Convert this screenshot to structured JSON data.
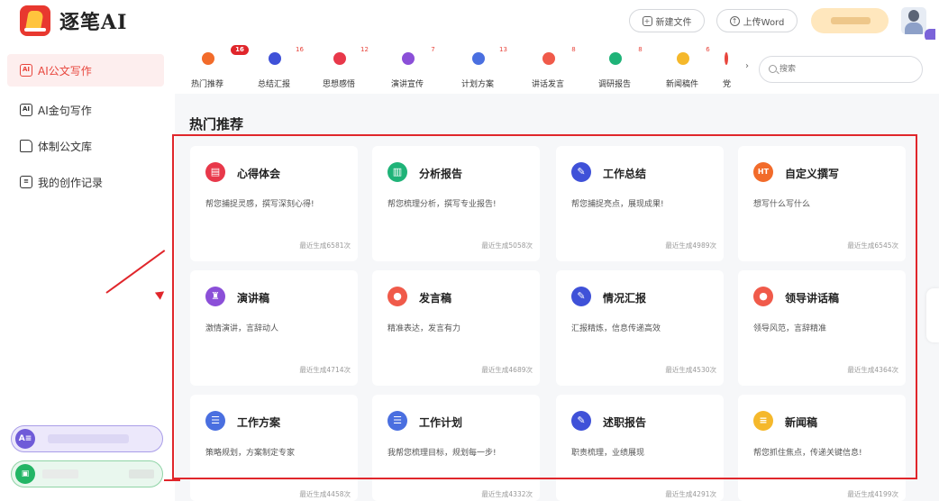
{
  "app": {
    "name": "逐笔AI"
  },
  "header": {
    "new_file": "新建文件",
    "upload_word": "上传Word"
  },
  "sidebar": {
    "items": [
      {
        "label": "AI公文写作",
        "active": true,
        "icon": "document-ai-icon"
      },
      {
        "label": "AI金句写作",
        "active": false,
        "icon": "quote-icon"
      },
      {
        "label": "体制公文库",
        "active": false,
        "icon": "folder-icon"
      },
      {
        "label": "我的创作记录",
        "active": false,
        "icon": "record-icon"
      }
    ],
    "bottom_pills": [
      {
        "icon_text": "A≡",
        "color": "#6f5bd8"
      },
      {
        "icon_text": "▣",
        "color": "#23b565"
      }
    ]
  },
  "tabs": [
    {
      "label": "热门推荐",
      "badge": "16",
      "color": "#f26b2a"
    },
    {
      "label": "总结汇报",
      "badge": "16",
      "color": "#3f51d8"
    },
    {
      "label": "思想感悟",
      "badge": "12",
      "color": "#e8384a"
    },
    {
      "label": "演讲宣传",
      "badge": "7",
      "color": "#8b4fd8"
    },
    {
      "label": "计划方案",
      "badge": "13",
      "color": "#4a6fe0"
    },
    {
      "label": "讲话发言",
      "badge": "8",
      "color": "#f05a4a"
    },
    {
      "label": "调研报告",
      "badge": "8",
      "color": "#1fb378"
    },
    {
      "label": "新闻稿件",
      "badge": "6",
      "color": "#f5b82b"
    },
    {
      "label": "党",
      "badge": "",
      "color": "#e8453c"
    }
  ],
  "search": {
    "placeholder": "搜索"
  },
  "section": {
    "title": "热门推荐"
  },
  "cards": [
    {
      "title": "心得体会",
      "desc": "帮您捕捉灵感，撰写深刻心得!",
      "count": "最近生成6581次",
      "color": "#e8384a",
      "icon": "heart-note-icon"
    },
    {
      "title": "分析报告",
      "desc": "帮您梳理分析，撰写专业报告!",
      "count": "最近生成5058次",
      "color": "#1fb378",
      "icon": "chart-doc-icon"
    },
    {
      "title": "工作总结",
      "desc": "帮您捕捉亮点，展现成果!",
      "count": "最近生成4989次",
      "color": "#3f51d8",
      "icon": "pen-doc-icon"
    },
    {
      "title": "自定义撰写",
      "desc": "想写什么写什么",
      "count": "最近生成6545次",
      "color": "#f26b2a",
      "icon": "flame-hot-icon"
    },
    {
      "title": "演讲稿",
      "desc": "激情演讲，言辞动人",
      "count": "最近生成4714次",
      "color": "#8b4fd8",
      "icon": "podium-icon"
    },
    {
      "title": "发言稿",
      "desc": "精准表达，发言有力",
      "count": "最近生成4689次",
      "color": "#f05a4a",
      "icon": "speaker-icon"
    },
    {
      "title": "情况汇报",
      "desc": "汇报精炼，信息传递高效",
      "count": "最近生成4530次",
      "color": "#3f51d8",
      "icon": "pen-doc-icon"
    },
    {
      "title": "领导讲话稿",
      "desc": "领导风范，言辞精准",
      "count": "最近生成4364次",
      "color": "#f05a4a",
      "icon": "speaker-icon"
    },
    {
      "title": "工作方案",
      "desc": "策略规划，方案制定专家",
      "count": "最近生成4458次",
      "color": "#4a6fe0",
      "icon": "plan-icon"
    },
    {
      "title": "工作计划",
      "desc": "我帮您梳理目标，规划每一步!",
      "count": "最近生成4332次",
      "color": "#4a6fe0",
      "icon": "plan-icon"
    },
    {
      "title": "述职报告",
      "desc": "职责梳理，业绩展现",
      "count": "最近生成4291次",
      "color": "#3f51d8",
      "icon": "pen-doc-icon"
    },
    {
      "title": "新闻稿",
      "desc": "帮您抓住焦点，传递关键信息!",
      "count": "最近生成4199次",
      "color": "#f5b82b",
      "icon": "news-icon"
    }
  ]
}
